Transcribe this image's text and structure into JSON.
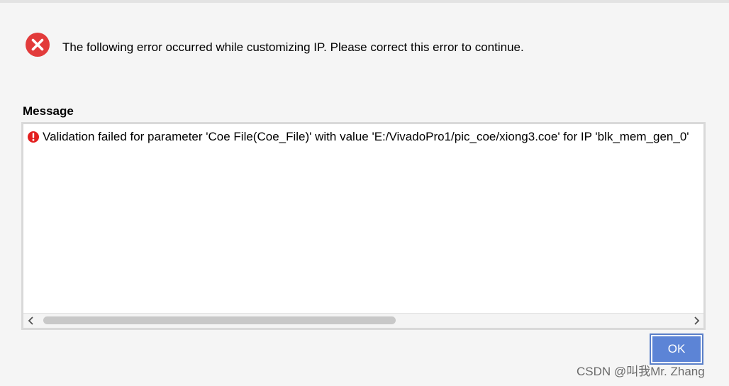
{
  "dialog": {
    "error_icon": "error-circle-x-icon",
    "error_message": "The following error occurred while customizing IP. Please correct this error to continue.",
    "message_section_label": "Message",
    "messages": [
      {
        "icon": "error-exclamation-icon",
        "text": "Validation failed for parameter 'Coe File(Coe_File)' with value 'E:/VivadoPro1/pic_coe/xiong3.coe' for IP 'blk_mem_gen_0'"
      }
    ],
    "ok_label": "OK"
  },
  "watermark": "CSDN @叫我Mr. Zhang",
  "colors": {
    "background": "#f5f5f5",
    "error_red": "#e23b3b",
    "ok_button": "#5c84d6",
    "ok_border": "#5a7fc8"
  }
}
